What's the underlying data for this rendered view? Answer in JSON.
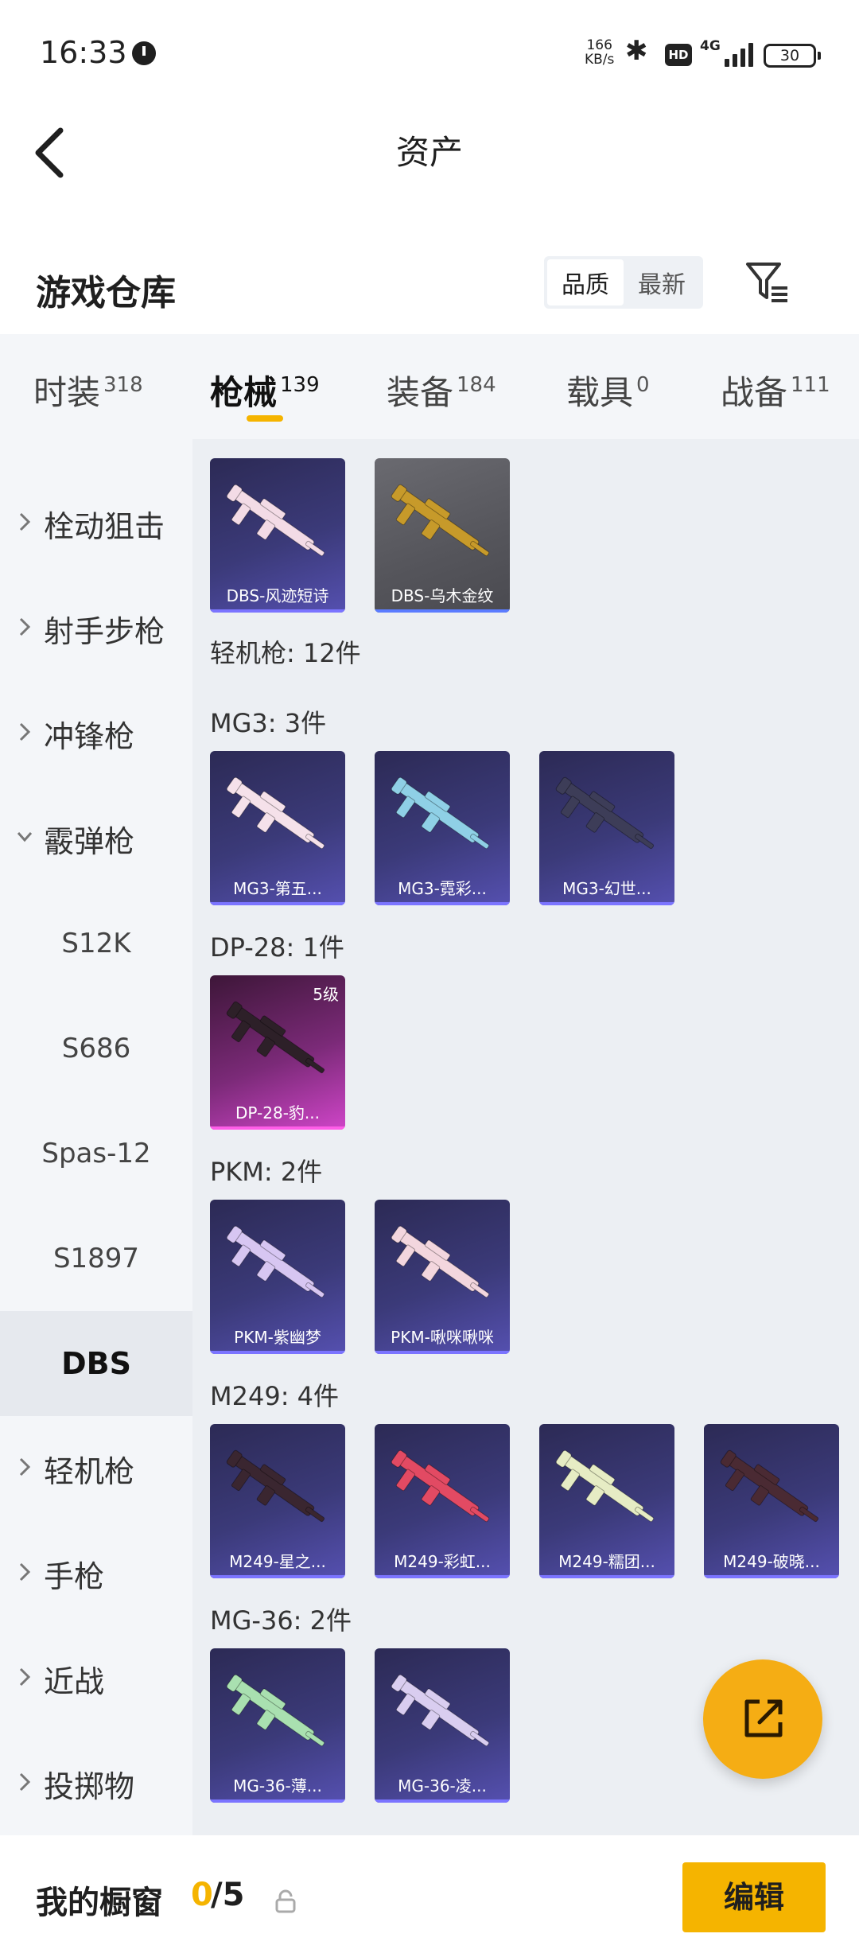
{
  "status_bar": {
    "time": "16:33",
    "net_speed_value": "166",
    "net_speed_unit": "KB/s",
    "hd_badge": "HD",
    "network": "4G",
    "battery": "30"
  },
  "header": {
    "title": "资产"
  },
  "section": {
    "title": "游戏仓库",
    "sort_options": [
      "品质",
      "最新"
    ],
    "sort_active": "品质"
  },
  "tabs": [
    {
      "label": "时装",
      "count": "318"
    },
    {
      "label": "枪械",
      "count": "139",
      "active": true
    },
    {
      "label": "装备",
      "count": "184"
    },
    {
      "label": "载具",
      "count": "0"
    },
    {
      "label": "战备",
      "count": "111"
    }
  ],
  "sidebar": {
    "items": [
      {
        "label": "栓动狙击",
        "type": "category"
      },
      {
        "label": "射手步枪",
        "type": "category"
      },
      {
        "label": "冲锋枪",
        "type": "category"
      },
      {
        "label": "霰弹枪",
        "type": "category",
        "expanded": true
      },
      {
        "label": "S12K",
        "type": "sub"
      },
      {
        "label": "S686",
        "type": "sub"
      },
      {
        "label": "Spas-12",
        "type": "sub"
      },
      {
        "label": "S1897",
        "type": "sub"
      },
      {
        "label": "DBS",
        "type": "sub",
        "selected": true
      },
      {
        "label": "轻机枪",
        "type": "category"
      },
      {
        "label": "手枪",
        "type": "category"
      },
      {
        "label": "近战",
        "type": "category"
      },
      {
        "label": "投掷物",
        "type": "category"
      }
    ]
  },
  "content": {
    "top_cards": [
      {
        "name": "DBS-风迹短诗",
        "style": "purple",
        "gun_color": "#f3dbe6"
      },
      {
        "name": "DBS-乌木金纹",
        "style": "grey",
        "gun_color": "#c79a2a"
      }
    ],
    "category_total": "轻机枪: 12件",
    "groups": [
      {
        "label": "MG3: 3件",
        "cards": [
          {
            "name": "MG3-第五...",
            "style": "purple",
            "gun_color": "#f5e1ea"
          },
          {
            "name": "MG3-霓彩...",
            "style": "purple",
            "gun_color": "#8fd0e6"
          },
          {
            "name": "MG3-幻世...",
            "style": "purple",
            "gun_color": "#3d3d58"
          }
        ]
      },
      {
        "label": "DP-28: 1件",
        "cards": [
          {
            "name": "DP-28-豹...",
            "style": "pink",
            "gun_color": "#2d2028",
            "level": "5级"
          }
        ]
      },
      {
        "label": "PKM: 2件",
        "cards": [
          {
            "name": "PKM-紫幽梦",
            "style": "purple",
            "gun_color": "#d7c6f2"
          },
          {
            "name": "PKM-啾咪啾咪",
            "style": "purple",
            "gun_color": "#f3d6de"
          }
        ]
      },
      {
        "label": "M249: 4件",
        "cards": [
          {
            "name": "M249-星之...",
            "style": "purple",
            "gun_color": "#3a2630"
          },
          {
            "name": "M249-彩虹...",
            "style": "purple",
            "gun_color": "#e24a63"
          },
          {
            "name": "M249-糯团...",
            "style": "purple",
            "gun_color": "#e6ecc4"
          },
          {
            "name": "M249-破晓...",
            "style": "purple",
            "gun_color": "#4a2a33"
          }
        ]
      },
      {
        "label": "MG-36: 2件",
        "cards": [
          {
            "name": "MG-36-薄...",
            "style": "purple",
            "gun_color": "#a9e0b0"
          },
          {
            "name": "MG-36-凌...",
            "style": "purple",
            "gun_color": "#d9cdf0"
          }
        ]
      }
    ]
  },
  "bottom": {
    "showcase_label": "我的橱窗",
    "count_current": "0",
    "count_rest": "/5",
    "edit_label": "编辑"
  },
  "colors": {
    "accent": "#f5b400",
    "fab": "#f5ad14"
  }
}
